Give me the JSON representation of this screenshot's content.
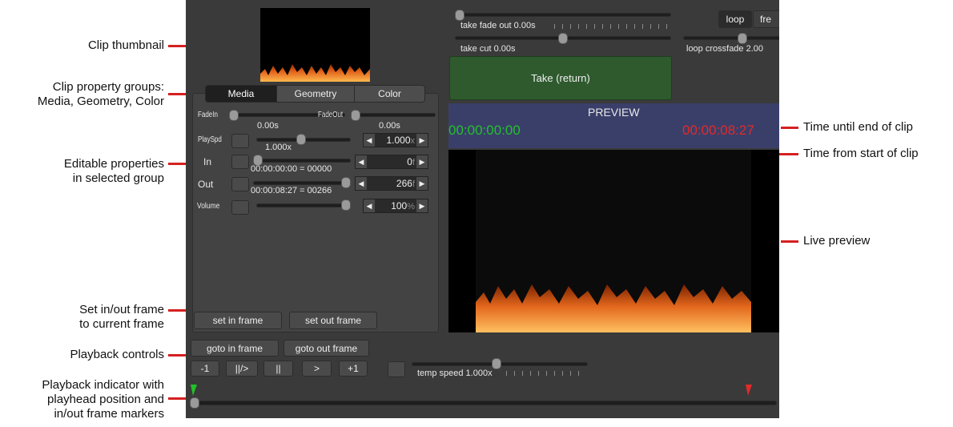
{
  "annotations": {
    "clip_thumbnail": "Clip thumbnail",
    "clip_property_groups_l1": "Clip property groups:",
    "clip_property_groups_l2": "Media, Geometry, Color",
    "editable_properties_l1": "Editable properties",
    "editable_properties_l2": "in selected group",
    "set_inout_l1": "Set in/out frame",
    "set_inout_l2": "to current frame",
    "playback_controls": "Playback controls",
    "playback_indicator_l1": "Playback indicator with",
    "playback_indicator_l2": "playhead position and",
    "playback_indicator_l3": "in/out frame markers",
    "time_until_end": "Time until end of clip",
    "time_from_start": "Time from start of clip",
    "live_preview": "Live preview"
  },
  "take": {
    "fade_out_label": "take fade out 0.00s",
    "cut_label": "take cut 0.00s",
    "take_button": "Take (return)",
    "loop_button": "loop",
    "free_button": "fre",
    "loop_crossfade_label": "loop crossfade 2.00"
  },
  "tabs": {
    "media": "Media",
    "geometry": "Geometry",
    "color": "Color",
    "selected": "Media"
  },
  "properties": {
    "fadein_label": "FadeIn",
    "fadein_value": "0.00s",
    "fadeout_label": "FadeOut",
    "fadeout_value": "0.00s",
    "playspd_label": "PlaySpd",
    "playspd_value": "1.000x",
    "playspd_stepper": "1.000",
    "playspd_unit": "x",
    "in_label": "In",
    "in_value": "00:00:00:00 = 00000",
    "in_stepper": "0",
    "in_unit": "f",
    "out_label": "Out",
    "out_value": "00:00:08:27 = 00266",
    "out_stepper": "266",
    "out_unit": "f",
    "volume_label": "Volume",
    "volume_stepper": "100",
    "volume_unit": "%"
  },
  "buttons": {
    "set_in_frame": "set in frame",
    "set_out_frame": "set out frame",
    "goto_in_frame": "goto in frame",
    "goto_out_frame": "goto out frame",
    "step_back": "-1",
    "play_pause": "||/>",
    "pause": "||",
    "play": ">",
    "step_forward": "+1"
  },
  "temp_speed_label": "temp speed 1.000x",
  "preview": {
    "title": "PREVIEW",
    "time_from_start": "00:00:00:00",
    "time_until_end": "00:00:08:27"
  },
  "colors": {
    "accent_green": "#22c12a",
    "accent_red": "#e22a2a",
    "annotation_red": "#d61f1f",
    "take_button_bg": "#2e5a2e",
    "preview_header_bg": "#3a3f6a"
  },
  "icons": {
    "stepper_left": "triangle-left-icon",
    "stepper_right": "triangle-right-icon",
    "in_marker": "green-flag-marker-icon",
    "out_marker": "red-flag-marker-icon"
  }
}
